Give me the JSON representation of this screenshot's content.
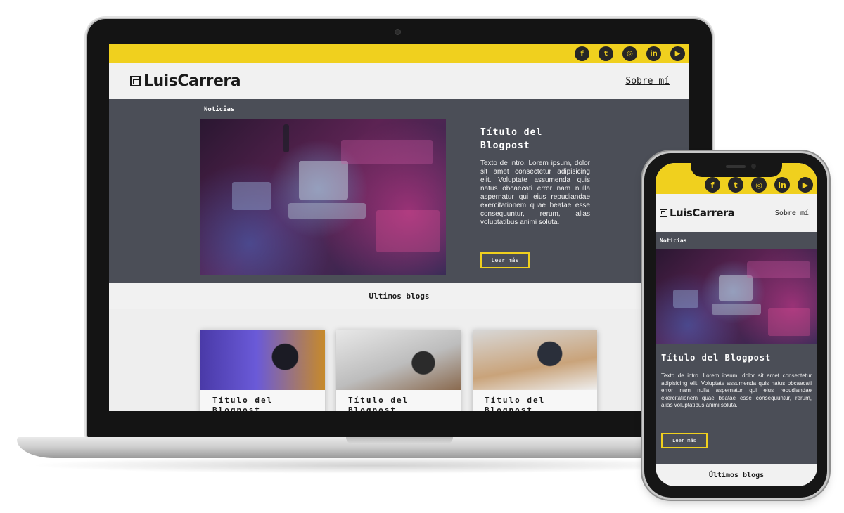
{
  "site": {
    "logo_text": "LuisCarrera",
    "nav_about": "Sobre mí",
    "social_icons": [
      {
        "name": "facebook-icon",
        "glyph": "f"
      },
      {
        "name": "tumblr-icon",
        "glyph": "t"
      },
      {
        "name": "instagram-icon",
        "glyph": "◎"
      },
      {
        "name": "linkedin-icon",
        "glyph": "in"
      },
      {
        "name": "youtube-icon",
        "glyph": "▶"
      }
    ],
    "hero": {
      "section_label": "Noticias",
      "title": "Título del Blogpost",
      "intro": "Texto de intro. Lorem ipsum, dolor sit amet consectetur adipisicing elit. Voluptate assumenda quis natus obcaecati error nam nulla aspernatur qui eius repudiandae exercitationem quae beatae esse consequuntur, rerum, alias voluptatibus animi soluta.",
      "button_label": "Leer más"
    },
    "latest_heading": "Últimos blogs",
    "blog_cards": [
      {
        "title": "Título del Blogpost"
      },
      {
        "title": "Título del Blogpost"
      },
      {
        "title": "Título del Blogpost"
      }
    ]
  },
  "colors": {
    "accent_yellow": "#f0d01e",
    "hero_background": "#4b4e57",
    "header_background": "#f1f1f1",
    "text_dark": "#1a1a1a"
  }
}
